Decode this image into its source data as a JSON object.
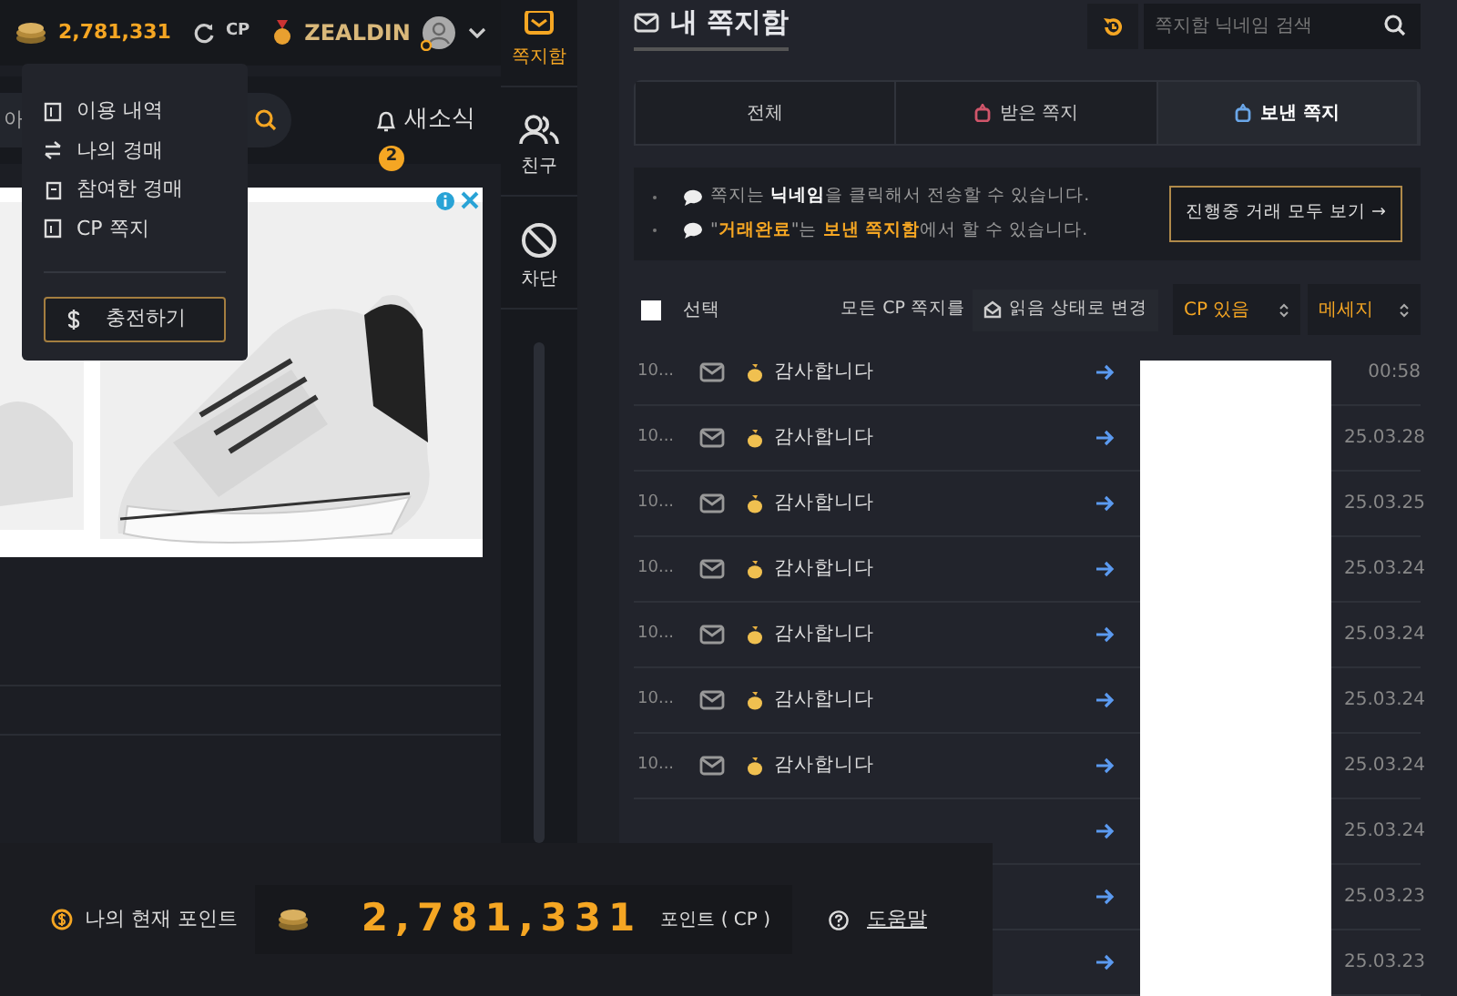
{
  "top_bar": {
    "points": "2,781,331",
    "currency": "CP",
    "username": "ZEALDIN"
  },
  "search_bar": {
    "value": "아",
    "news_label": "새소식",
    "news_count": "2"
  },
  "user_menu": {
    "items": [
      "이용 내역",
      "나의 경매",
      "참여한 경매",
      "CP 쪽지"
    ],
    "charge_button": "충전하기"
  },
  "side_nav": [
    {
      "label": "쪽지함",
      "selected": true
    },
    {
      "label": "친구",
      "selected": false
    },
    {
      "label": "차단",
      "selected": false
    }
  ],
  "inbox": {
    "title": "내 쪽지함",
    "search_placeholder": "쪽지함 닉네임 검색",
    "tabs": [
      {
        "label": "전체",
        "selected": false
      },
      {
        "label": "받은 쪽지",
        "selected": false
      },
      {
        "label": "보낸 쪽지",
        "selected": true
      }
    ],
    "notices": [
      {
        "kind": "plain",
        "text": "쪽지는 **닉네임**을 클릭해서 전송할 수 있습니다."
      },
      {
        "kind": "accent",
        "text": "\"**거래완료**\"는 **보낸 쪽지함**에서 할 수 있습니다."
      }
    ],
    "trade_button": "진행중 거래 모두 보기 →",
    "toolbar": {
      "select_label": "선택",
      "select_all_checked": false,
      "all_cp_label": "모든 CP 쪽지를",
      "mark_read_button": "읽음 상태로 변경",
      "filter": "CP 있음",
      "sort": "메세지"
    },
    "rows": [
      {
        "number": "10...",
        "subject": "감사합니다",
        "date": "00:58"
      },
      {
        "number": "10...",
        "subject": "감사합니다",
        "date": "25.03.28"
      },
      {
        "number": "10...",
        "subject": "감사합니다",
        "date": "25.03.25"
      },
      {
        "number": "10...",
        "subject": "감사합니다",
        "date": "25.03.24"
      },
      {
        "number": "10...",
        "subject": "감사합니다",
        "date": "25.03.24"
      },
      {
        "number": "10...",
        "subject": "감사합니다",
        "date": "25.03.24"
      },
      {
        "number": "10...",
        "subject": "감사합니다",
        "date": "25.03.24"
      },
      {
        "date": "25.03.24"
      },
      {
        "date": "25.03.23"
      },
      {
        "date": "25.03.23"
      }
    ]
  },
  "points_bar": {
    "label": "나의 현재 포인트",
    "amount": "2,781,331",
    "unit": "포인트 ( CP )",
    "help": "도움말"
  }
}
